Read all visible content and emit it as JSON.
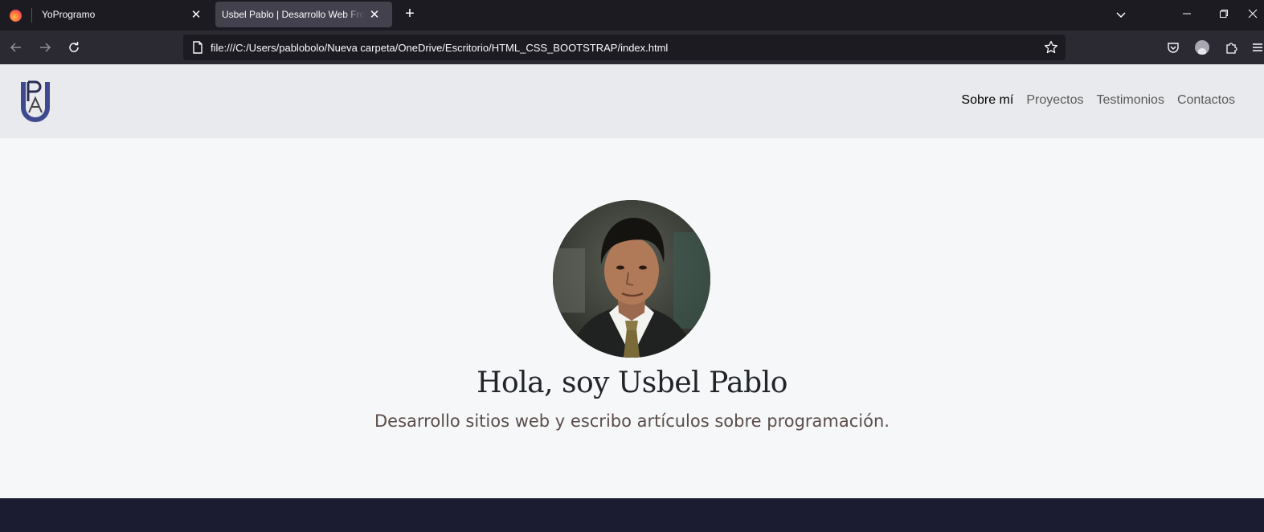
{
  "browser": {
    "tabs": [
      {
        "title": "YoProgramo",
        "active": false
      },
      {
        "title": "Usbel Pablo | Desarrollo Web Front-",
        "active": true
      }
    ],
    "url": "file:///C:/Users/pablobolo/Nueva carpeta/OneDrive/Escritorio/HTML_CSS_BOOTSTRAP/index.html"
  },
  "site": {
    "logo_text": "PA",
    "menu": [
      {
        "label": "Sobre mí",
        "active": true
      },
      {
        "label": "Proyectos",
        "active": false
      },
      {
        "label": "Testimonios",
        "active": false
      },
      {
        "label": "Contactos",
        "active": false
      }
    ],
    "hero": {
      "title": "Hola, soy Usbel Pablo",
      "subtitle": "Desarrollo sitios web y escribo artículos sobre programación."
    }
  },
  "colors": {
    "nav_bg": "#e9eaed",
    "page_bg": "#f5f7f9",
    "footer_bg": "#1b1b31",
    "logo_accent": "#3d4a8f"
  }
}
